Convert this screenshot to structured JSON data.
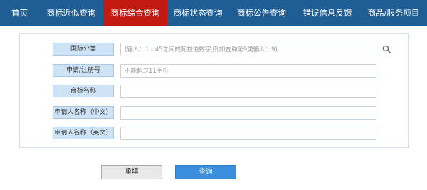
{
  "nav": {
    "items": [
      {
        "label": "首页",
        "active": false
      },
      {
        "label": "商标近似查询",
        "active": false
      },
      {
        "label": "商标综合查询",
        "active": true
      },
      {
        "label": "商标状态查询",
        "active": false
      },
      {
        "label": "商标公告查询",
        "active": false
      },
      {
        "label": "错误信息反馈",
        "active": false
      },
      {
        "label": "商品/服务项目",
        "active": false
      }
    ]
  },
  "form": {
    "fields": [
      {
        "label": "国际分类",
        "placeholder": "(输入：1 - 45之间的阿拉伯数字,例如查询第9类输入：9)",
        "value": ""
      },
      {
        "label": "申请/注册号",
        "placeholder": "不能超过11字符",
        "value": ""
      },
      {
        "label": "商标名称",
        "placeholder": "",
        "value": ""
      },
      {
        "label": "申请人名称（中文）",
        "placeholder": "",
        "value": ""
      },
      {
        "label": "申请人名称（英文）",
        "placeholder": "",
        "value": ""
      }
    ]
  },
  "buttons": {
    "reset_label": "重填",
    "search_label": "查询"
  },
  "colors": {
    "nav_bg": "#1f5d95",
    "nav_active": "#c21a10",
    "label_bg": "#cfe3f6",
    "search_button": "#3b8fdc"
  }
}
